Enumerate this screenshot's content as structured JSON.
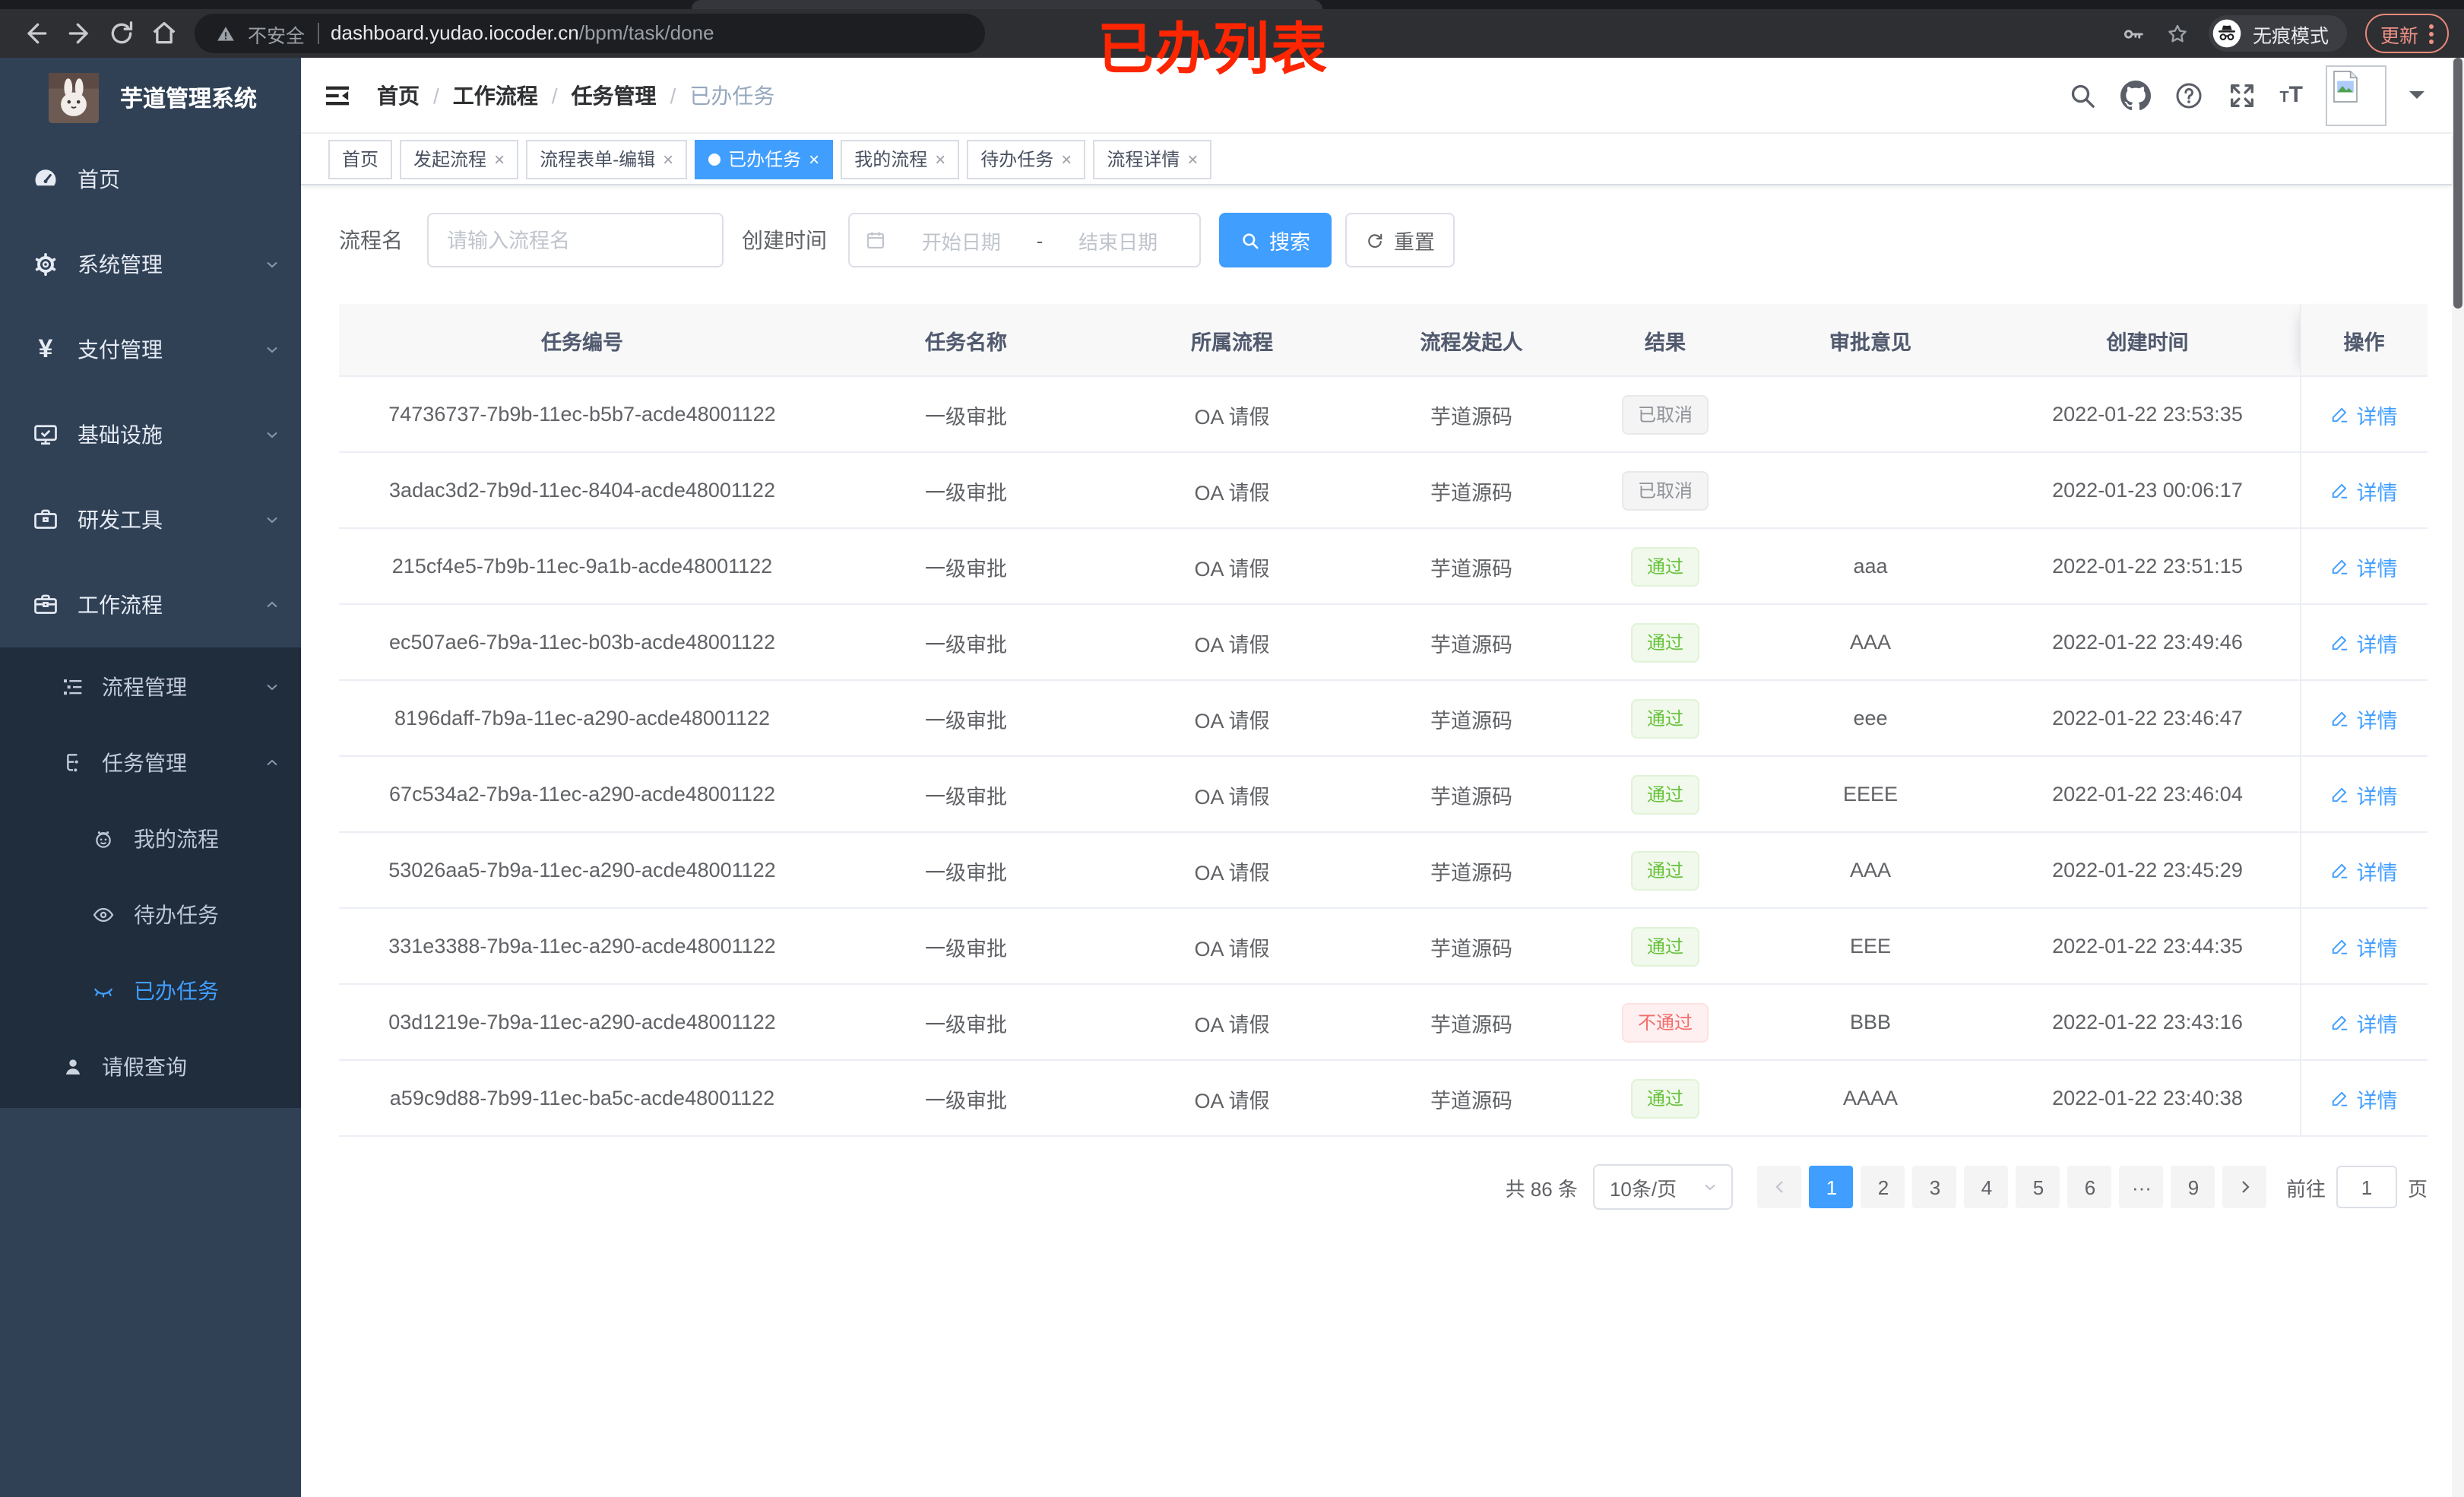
{
  "annotation": {
    "label": "已办列表"
  },
  "colors": {
    "accent": "#409eff",
    "success": "#67c23a",
    "danger": "#f56c6c",
    "info": "#909399",
    "sidebar_bg": "#304156",
    "submenu_bg": "#1f2d3d",
    "annotation": "#fd2600"
  },
  "browser": {
    "security_label": "不安全",
    "url_host": "dashboard.yudao.iocoder.cn",
    "url_path": "/bpm/task/done",
    "incognito_label": "无痕模式",
    "update_label": "更新"
  },
  "icons": {
    "close": "×",
    "more": "···",
    "prev": "‹",
    "next": "›"
  },
  "sidebar": {
    "title": "芋道管理系统",
    "items": [
      {
        "label": "首页"
      },
      {
        "label": "系统管理"
      },
      {
        "label": "支付管理"
      },
      {
        "label": "基础设施"
      },
      {
        "label": "研发工具"
      },
      {
        "label": "工作流程"
      }
    ],
    "sub_items": [
      {
        "label": "流程管理"
      },
      {
        "label": "任务管理"
      },
      {
        "label": "我的流程"
      },
      {
        "label": "待办任务"
      },
      {
        "label": "已办任务"
      },
      {
        "label": "请假查询"
      }
    ],
    "yen_glyph": "¥"
  },
  "navbar": {
    "breadcrumb": [
      "首页",
      "工作流程",
      "任务管理",
      "已办任务"
    ],
    "separator": "/"
  },
  "tags": [
    {
      "label": "首页"
    },
    {
      "label": "发起流程"
    },
    {
      "label": "流程表单-编辑"
    },
    {
      "label": "已办任务"
    },
    {
      "label": "我的流程"
    },
    {
      "label": "待办任务"
    },
    {
      "label": "流程详情"
    }
  ],
  "filter": {
    "name_label": "流程名",
    "name_placeholder": "请输入流程名",
    "time_label": "创建时间",
    "start_placeholder": "开始日期",
    "range_separator": "-",
    "end_placeholder": "结束日期",
    "search_label": "搜索",
    "reset_label": "重置"
  },
  "table": {
    "columns": [
      "任务编号",
      "任务名称",
      "所属流程",
      "流程发起人",
      "结果",
      "审批意见",
      "创建时间",
      "操作"
    ],
    "action_label": "详情",
    "rows": [
      {
        "id": "74736737-7b9b-11ec-b5b7-acde48001122",
        "name": "一级审批",
        "process": "OA 请假",
        "starter": "芋道源码",
        "result": "已取消",
        "result_type": "cancel",
        "comment": "",
        "created": "2022-01-22 23:53:35"
      },
      {
        "id": "3adac3d2-7b9d-11ec-8404-acde48001122",
        "name": "一级审批",
        "process": "OA 请假",
        "starter": "芋道源码",
        "result": "已取消",
        "result_type": "cancel",
        "comment": "",
        "created": "2022-01-23 00:06:17"
      },
      {
        "id": "215cf4e5-7b9b-11ec-9a1b-acde48001122",
        "name": "一级审批",
        "process": "OA 请假",
        "starter": "芋道源码",
        "result": "通过",
        "result_type": "pass",
        "comment": "aaa",
        "created": "2022-01-22 23:51:15"
      },
      {
        "id": "ec507ae6-7b9a-11ec-b03b-acde48001122",
        "name": "一级审批",
        "process": "OA 请假",
        "starter": "芋道源码",
        "result": "通过",
        "result_type": "pass",
        "comment": "AAA",
        "created": "2022-01-22 23:49:46"
      },
      {
        "id": "8196daff-7b9a-11ec-a290-acde48001122",
        "name": "一级审批",
        "process": "OA 请假",
        "starter": "芋道源码",
        "result": "通过",
        "result_type": "pass",
        "comment": "eee",
        "created": "2022-01-22 23:46:47"
      },
      {
        "id": "67c534a2-7b9a-11ec-a290-acde48001122",
        "name": "一级审批",
        "process": "OA 请假",
        "starter": "芋道源码",
        "result": "通过",
        "result_type": "pass",
        "comment": "EEEE",
        "created": "2022-01-22 23:46:04"
      },
      {
        "id": "53026aa5-7b9a-11ec-a290-acde48001122",
        "name": "一级审批",
        "process": "OA 请假",
        "starter": "芋道源码",
        "result": "通过",
        "result_type": "pass",
        "comment": "AAA",
        "created": "2022-01-22 23:45:29"
      },
      {
        "id": "331e3388-7b9a-11ec-a290-acde48001122",
        "name": "一级审批",
        "process": "OA 请假",
        "starter": "芋道源码",
        "result": "通过",
        "result_type": "pass",
        "comment": "EEE",
        "created": "2022-01-22 23:44:35"
      },
      {
        "id": "03d1219e-7b9a-11ec-a290-acde48001122",
        "name": "一级审批",
        "process": "OA 请假",
        "starter": "芋道源码",
        "result": "不通过",
        "result_type": "fail",
        "comment": "BBB",
        "created": "2022-01-22 23:43:16"
      },
      {
        "id": "a59c9d88-7b99-11ec-ba5c-acde48001122",
        "name": "一级审批",
        "process": "OA 请假",
        "starter": "芋道源码",
        "result": "通过",
        "result_type": "pass",
        "comment": "AAAA",
        "created": "2022-01-22 23:40:38"
      }
    ]
  },
  "pagination": {
    "total": "共 86 条",
    "page_size": "10条/页",
    "pages": [
      "1",
      "2",
      "3",
      "4",
      "5",
      "6"
    ],
    "last_page": "9",
    "goto_label": "前往",
    "goto_value": "1",
    "unit_label": "页"
  }
}
